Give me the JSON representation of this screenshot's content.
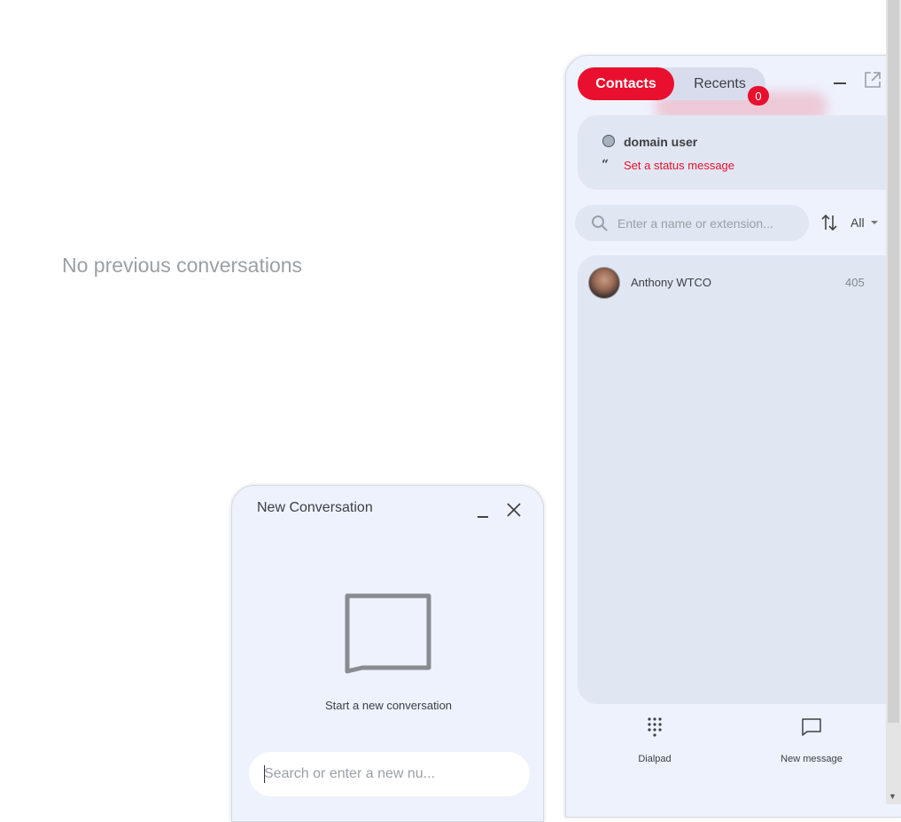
{
  "main": {
    "empty_message": "No previous conversations"
  },
  "contacts_panel": {
    "tabs": [
      {
        "label": "Contacts",
        "active": true
      },
      {
        "label": "Recents",
        "active": false
      }
    ],
    "recents_badge": "0",
    "user": {
      "name": "domain user",
      "status_message_link": "Set a status message"
    },
    "search": {
      "placeholder": "Enter a name or extension..."
    },
    "filter": {
      "selected": "All"
    },
    "contacts": [
      {
        "name": "Anthony WTCO",
        "extension": "405"
      }
    ],
    "bottom": {
      "dialpad_label": "Dialpad",
      "new_message_label": "New message"
    }
  },
  "new_conversation": {
    "title": "New Conversation",
    "empty_text": "Start a new conversation",
    "search_placeholder": "Search or enter a new nu..."
  },
  "colors": {
    "accent": "#e8102e",
    "panel_bg": "#eef2fd",
    "card_bg": "#e1e6f3"
  },
  "icons": [
    "minimize-icon",
    "popout-icon",
    "status-dot-icon",
    "quote-icon",
    "search-icon",
    "sort-icon",
    "caret-down-icon",
    "avatar",
    "dialpad-icon",
    "chat-icon",
    "close-icon",
    "chat-large-icon"
  ]
}
